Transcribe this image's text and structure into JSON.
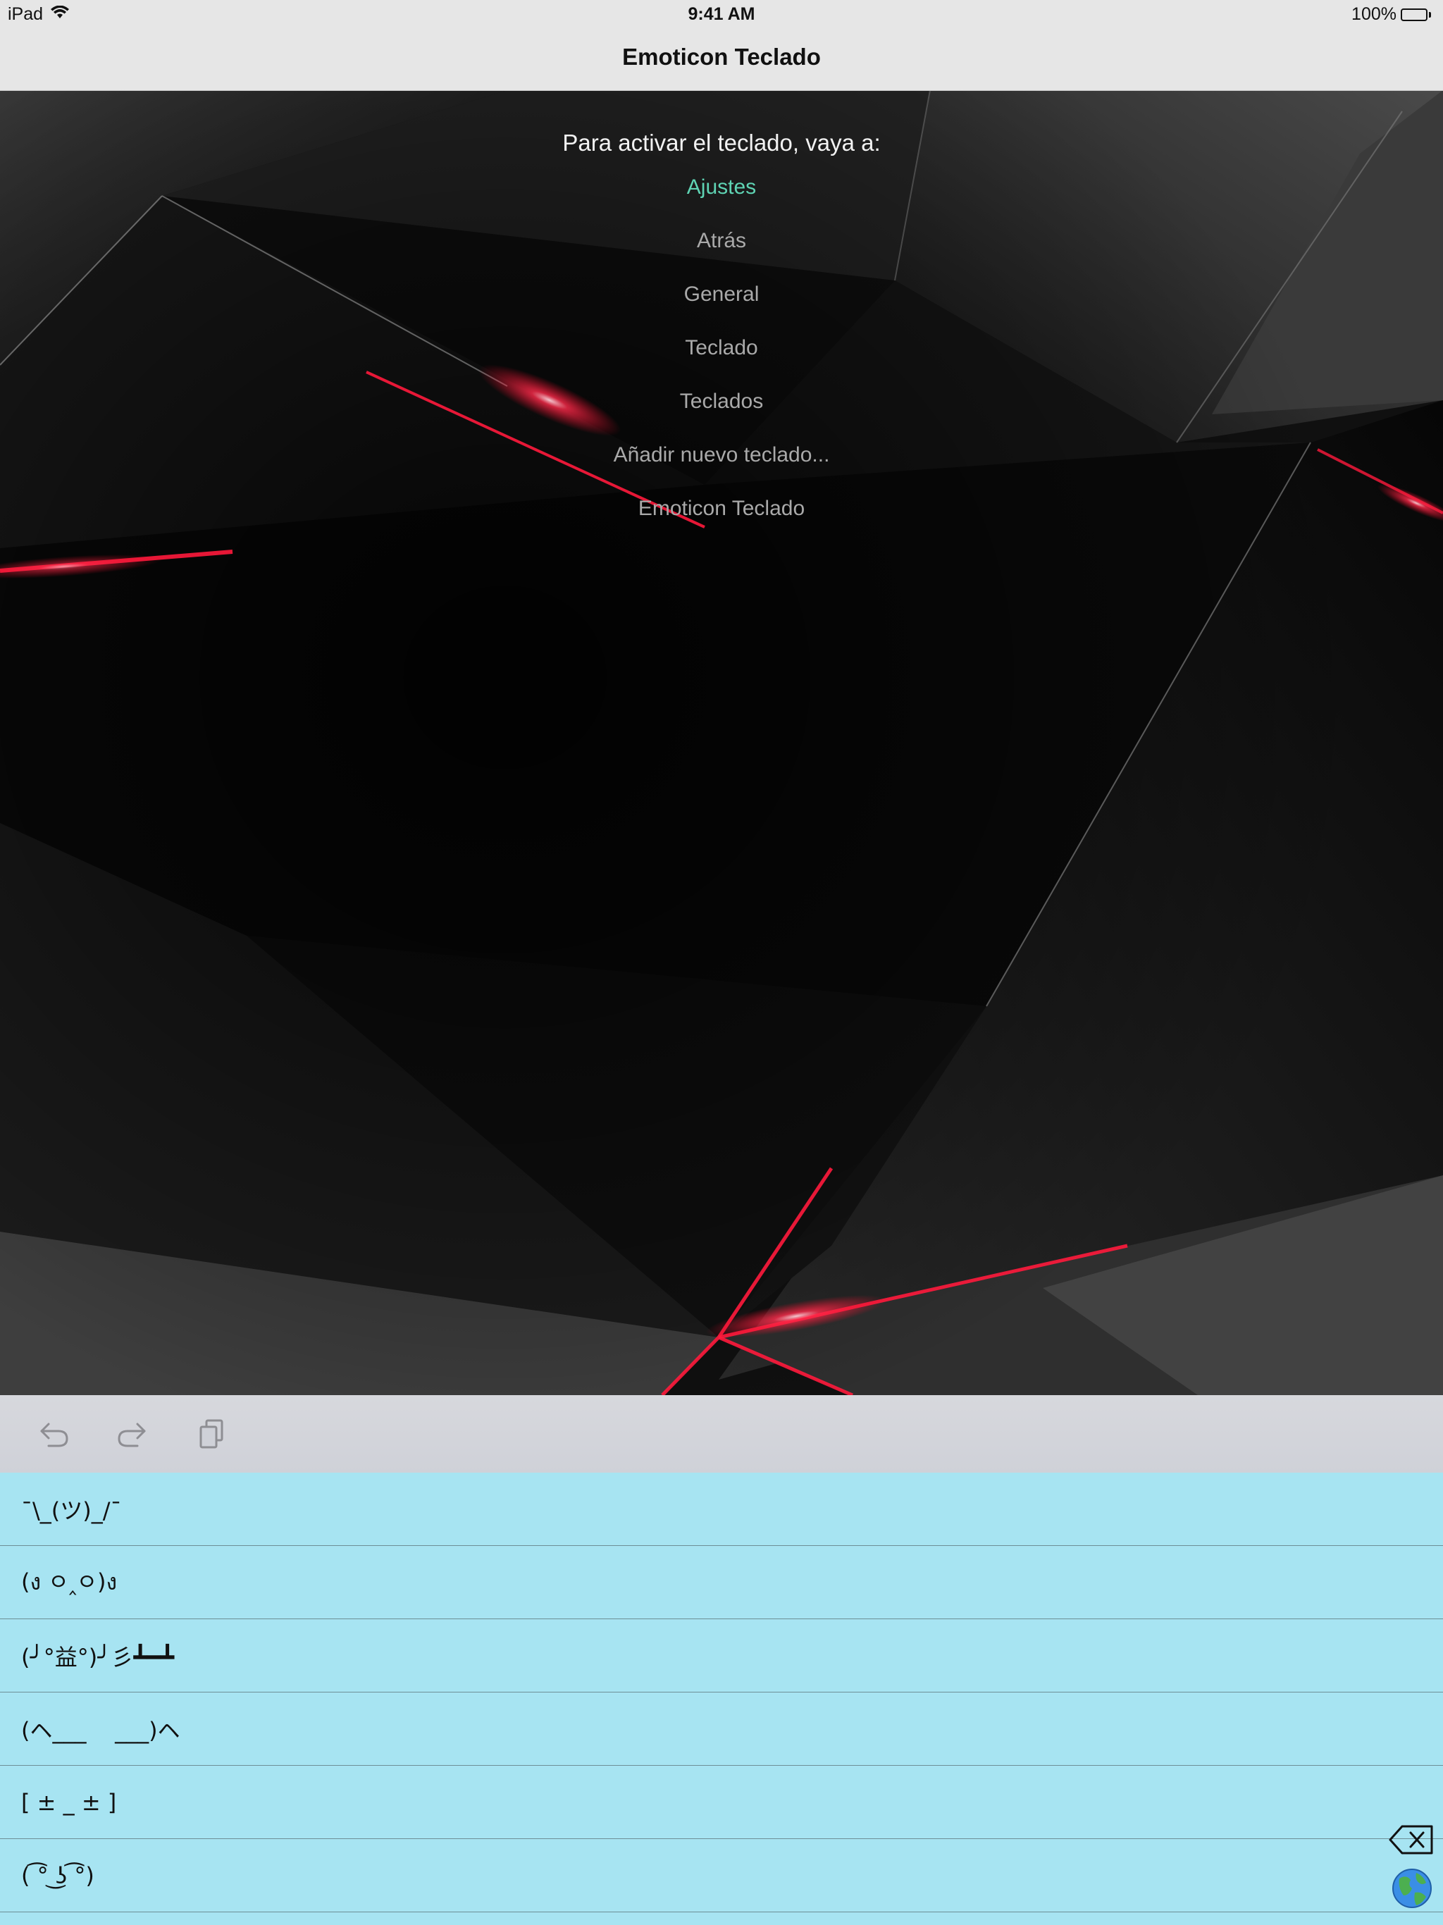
{
  "status_bar": {
    "device": "iPad",
    "time": "9:41 AM",
    "battery": "100%"
  },
  "nav": {
    "title": "Emoticon Teclado"
  },
  "instructions": {
    "heading": "Para activar el teclado, vaya a:",
    "steps": [
      "Ajustes",
      "Atrás",
      "General",
      "Teclado",
      "Teclados",
      "Añadir nuevo teclado...",
      "Emoticon Teclado"
    ]
  },
  "keyboard": {
    "toolbar_icons": [
      "undo-icon",
      "redo-icon",
      "paste-icon"
    ],
    "emoticons": [
      "¯\\_(ツ)_/¯",
      "(ง ㅇ‸ㅇ)ง",
      "(╯°益°)╯彡┻━┻",
      "(ヘ___    ___)ヘ",
      "[ ± _ ± ]",
      "( ͡° ͜ʖ ͡°)"
    ],
    "icons": [
      "backspace-icon",
      "globe-icon"
    ]
  },
  "colors": {
    "accent": "#5fd4b4",
    "keyboard_list_bg": "#a7e4f2",
    "wallpaper_glow": "#ff1a3c"
  }
}
